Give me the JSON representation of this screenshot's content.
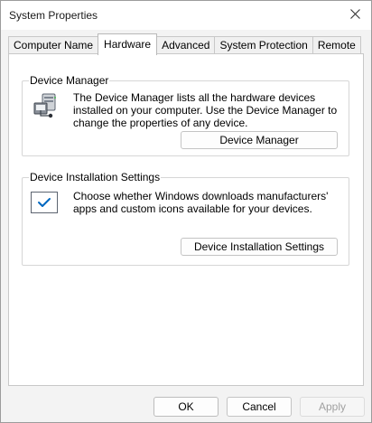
{
  "window": {
    "title": "System Properties",
    "close_icon": "close-icon"
  },
  "tabs": [
    {
      "label": "Computer Name",
      "active": false
    },
    {
      "label": "Hardware",
      "active": true
    },
    {
      "label": "Advanced",
      "active": false
    },
    {
      "label": "System Protection",
      "active": false
    },
    {
      "label": "Remote",
      "active": false
    }
  ],
  "device_manager": {
    "legend": "Device Manager",
    "icon": "device-manager-icon",
    "description": "The Device Manager lists all the hardware devices installed on your computer. Use the Device Manager to change the properties of any device.",
    "button_label": "Device Manager"
  },
  "device_installation": {
    "legend": "Device Installation Settings",
    "icon": "checkmark-icon",
    "description": "Choose whether Windows downloads manufacturers' apps and custom icons available for your devices.",
    "button_label": "Device Installation Settings"
  },
  "footer": {
    "ok_label": "OK",
    "cancel_label": "Cancel",
    "apply_label": "Apply",
    "apply_enabled": false
  },
  "colors": {
    "accent": "#0067c0"
  }
}
